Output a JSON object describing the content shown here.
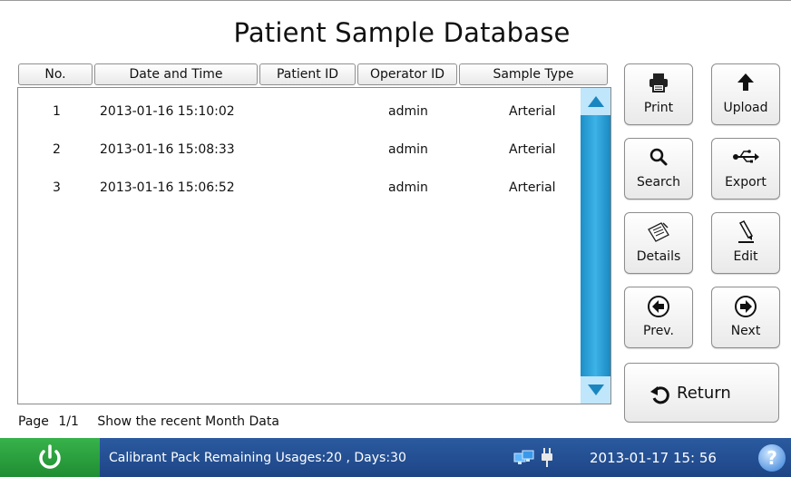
{
  "title": "Patient Sample Database",
  "columns": {
    "no": "No.",
    "datetime": "Date and Time",
    "patient_id": "Patient ID",
    "operator_id": "Operator ID",
    "sample_type": "Sample Type"
  },
  "rows": [
    {
      "no": "1",
      "datetime": "2013-01-16 15:10:02",
      "patient_id": "",
      "operator_id": "admin",
      "sample_type": "Arterial"
    },
    {
      "no": "2",
      "datetime": "2013-01-16 15:08:33",
      "patient_id": "",
      "operator_id": "admin",
      "sample_type": "Arterial"
    },
    {
      "no": "3",
      "datetime": "2013-01-16 15:06:52",
      "patient_id": "",
      "operator_id": "admin",
      "sample_type": "Arterial"
    }
  ],
  "buttons": {
    "print": "Print",
    "upload": "Upload",
    "search": "Search",
    "export": "Export",
    "details": "Details",
    "edit": "Edit",
    "prev": "Prev.",
    "next": "Next",
    "return": "Return"
  },
  "icons": {
    "print": "printer-icon",
    "upload": "arrow-up-icon",
    "search": "magnifier-icon",
    "export": "usb-icon",
    "details": "notepad-icon",
    "edit": "pencil-icon",
    "prev": "circle-left-arrow-icon",
    "next": "circle-right-arrow-icon",
    "return": "return-arrow-icon"
  },
  "page": {
    "label": "Page",
    "value": "1/1",
    "filter_text": "Show the recent Month Data"
  },
  "status": {
    "message": "Calibrant Pack Remaining Usages:20 , Days:30",
    "datetime": "2013-01-17  15: 56",
    "help": "?"
  },
  "colors": {
    "status_bar": "#1d4585",
    "power_button": "#2aa03d",
    "scrollbar": "#2ea2d8"
  }
}
